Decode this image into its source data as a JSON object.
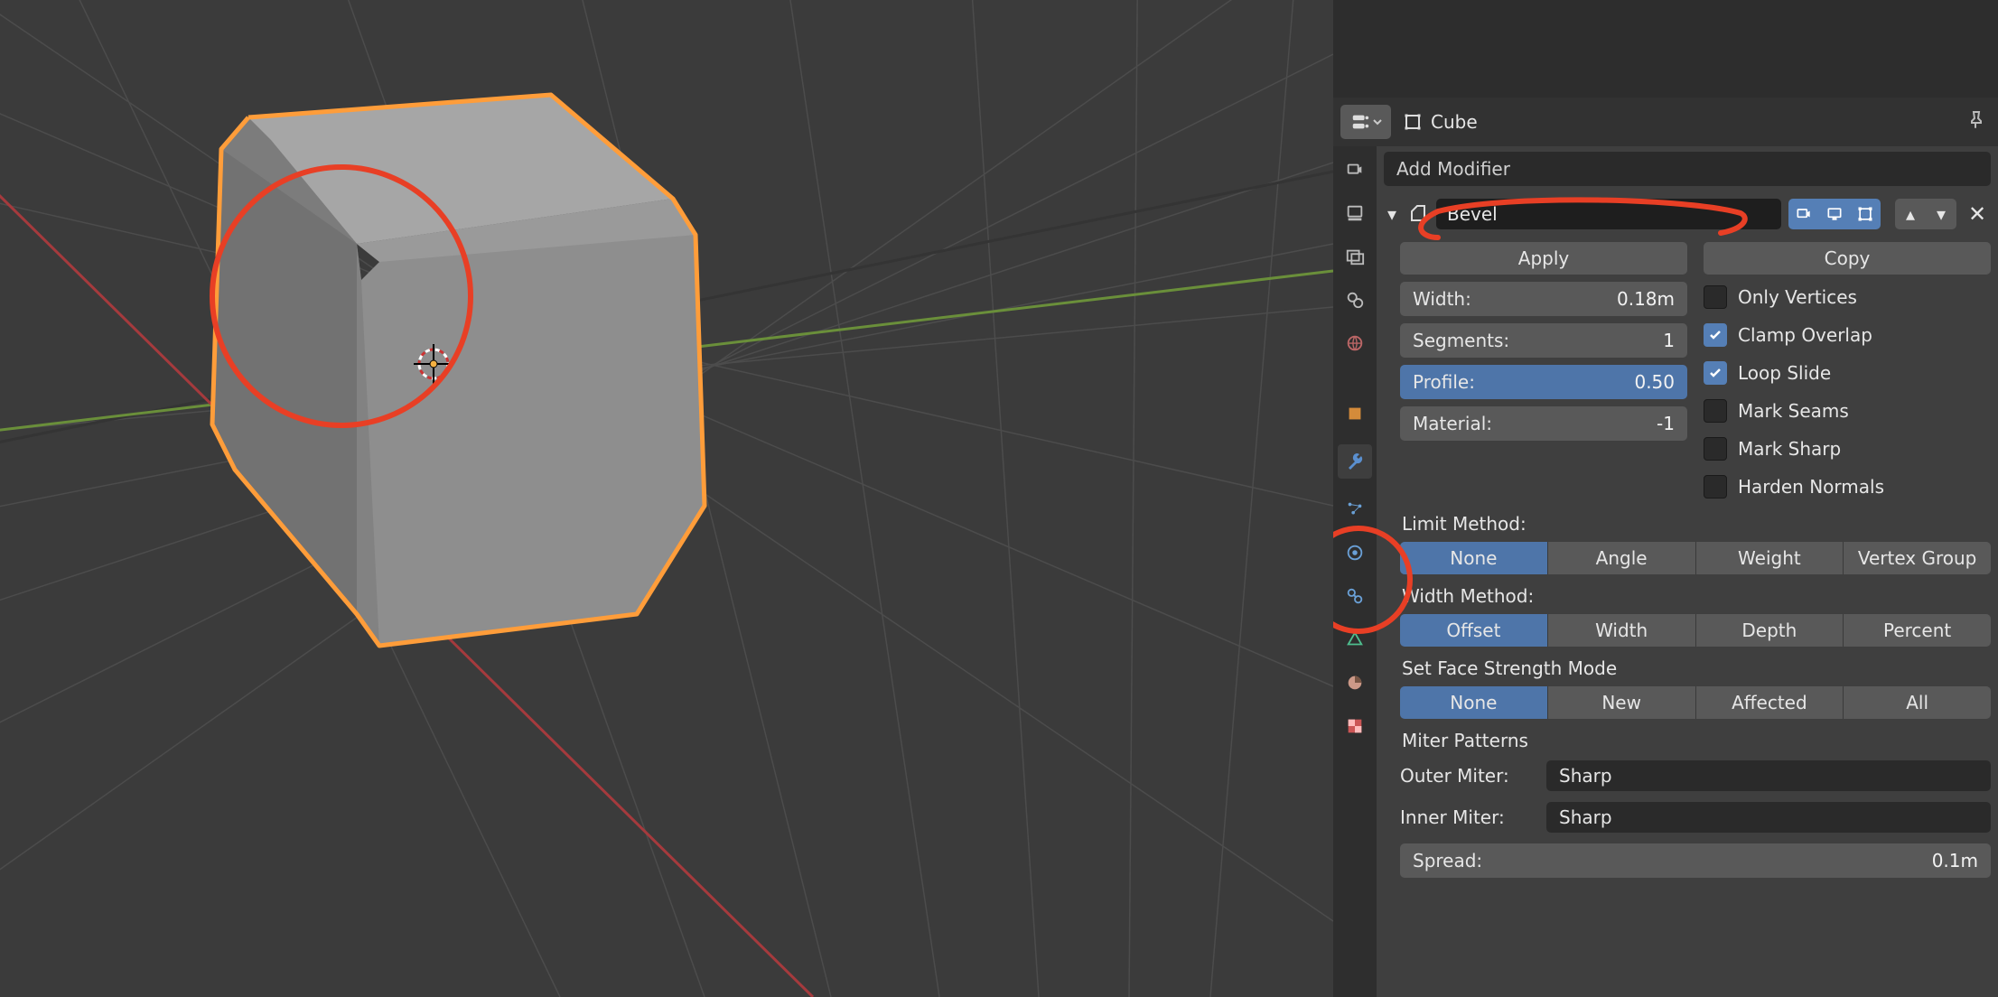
{
  "header": {
    "object_name": "Cube"
  },
  "add_modifier_label": "Add Modifier",
  "modifier": {
    "name": "Bevel",
    "apply_label": "Apply",
    "copy_label": "Copy",
    "width_label": "Width:",
    "width_value": "0.18m",
    "segments_label": "Segments:",
    "segments_value": "1",
    "profile_label": "Profile:",
    "profile_value": "0.50",
    "material_label": "Material:",
    "material_value": "-1",
    "only_vertices": "Only Vertices",
    "clamp_overlap": "Clamp Overlap",
    "loop_slide": "Loop Slide",
    "mark_seams": "Mark Seams",
    "mark_sharp": "Mark Sharp",
    "harden_normals": "Harden Normals",
    "limit_method_label": "Limit Method:",
    "limit_options": [
      "None",
      "Angle",
      "Weight",
      "Vertex Group"
    ],
    "limit_selected": 0,
    "width_method_label": "Width Method:",
    "width_options": [
      "Offset",
      "Width",
      "Depth",
      "Percent"
    ],
    "width_selected": 0,
    "face_strength_label": "Set Face Strength Mode",
    "face_options": [
      "None",
      "New",
      "Affected",
      "All"
    ],
    "face_selected": 0,
    "miter_label": "Miter Patterns",
    "outer_miter_label": "Outer Miter:",
    "outer_miter_value": "Sharp",
    "inner_miter_label": "Inner Miter:",
    "inner_miter_value": "Sharp",
    "spread_label": "Spread:",
    "spread_value": "0.1m"
  },
  "tabs": [
    "render",
    "output",
    "view-layer",
    "scene",
    "world",
    "object",
    "modifiers",
    "particles",
    "physics",
    "constraints",
    "data",
    "material",
    "texture"
  ],
  "active_tab": 6
}
